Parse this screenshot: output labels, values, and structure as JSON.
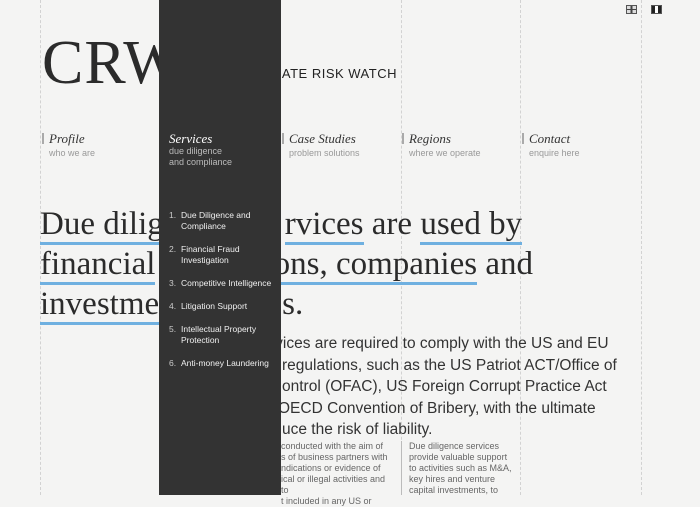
{
  "header": {
    "logo": "CRW",
    "tagline": "RATE RISK WATCH",
    "lang_icons": [
      "uk-flag-icon",
      "alt-flag-icon"
    ]
  },
  "nav": [
    {
      "title": "Profile",
      "desc": "who we are"
    },
    {
      "title": "Services",
      "desc": "due diligence\nand compliance"
    },
    {
      "title": "Case Studies",
      "desc": "problem solutions"
    },
    {
      "title": "Regions",
      "desc": "where we operate"
    },
    {
      "title": "Contact",
      "desc": "enquire here"
    }
  ],
  "dropdown": {
    "title": "Services",
    "desc_1": "due diligence",
    "desc_2": "and compliance",
    "items": [
      {
        "num": "1.",
        "label": "Due Diligence and Compliance"
      },
      {
        "num": "2.",
        "label": "Financial Fraud Investigation"
      },
      {
        "num": "3.",
        "label": "Competitive Intelligence"
      },
      {
        "num": "4.",
        "label": "Litigation Support"
      },
      {
        "num": "5.",
        "label": "Intellectual Property Protection"
      },
      {
        "num": "6.",
        "label": "Anti-money Laundering"
      }
    ]
  },
  "headline": {
    "line1_a": "Due dilig",
    "line1_b": "rvices",
    "line1_c": " are ",
    "line1_d": "used by",
    "line2_a": "financial",
    "line2_b": "ions, ",
    "line2_c": "companies",
    "line2_d": " and",
    "line3_a": "investme",
    "line3_b": "s."
  },
  "body": {
    "lines": [
      "rvices are required to comply with the US and EU",
      "regulations, such as the US Patriot ACT/Office of",
      "ontrol (OFAC), US Foreign Corrupt Practice Act",
      "OECD Convention of Bribery, with the ultimate",
      "uce the risk of liability."
    ]
  },
  "columns": {
    "left": [
      "conducted with the aim of",
      "s of business partners with",
      "ndications or evidence of",
      "ical or illegal activities and to",
      "t included in any US or"
    ],
    "right": [
      "Due diligence services",
      "provide valuable support",
      "to activities such as M&A,",
      "key hires and venture",
      "capital investments, to"
    ]
  },
  "colors": {
    "panel": "#333333",
    "underline": "#6fb0e0",
    "background": "#f4f4f3"
  }
}
